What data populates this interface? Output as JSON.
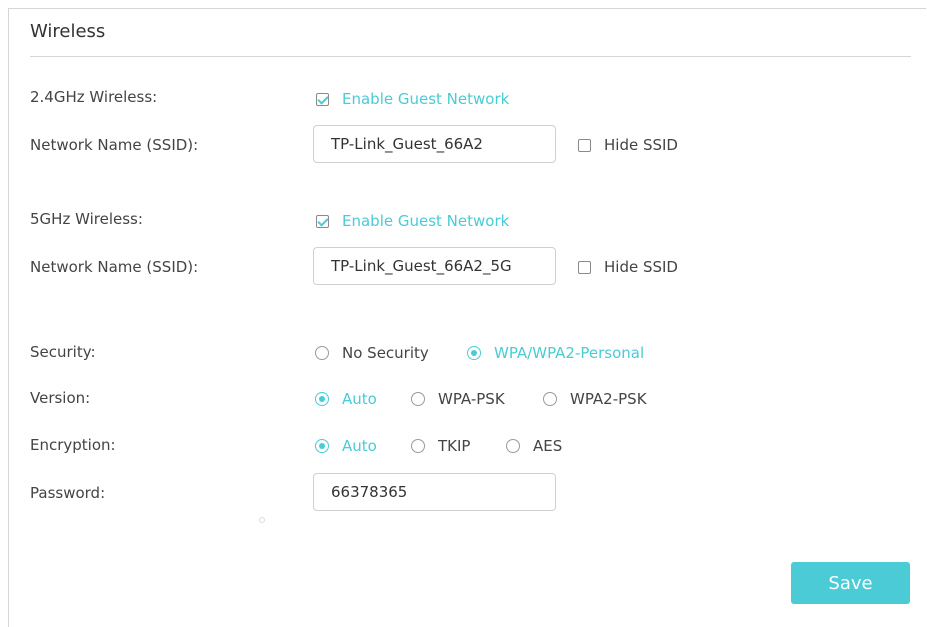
{
  "section": {
    "title": "Wireless"
  },
  "band24": {
    "label": "2.4GHz Wireless:",
    "enable_label": "Enable Guest Network",
    "enable_checked": true,
    "ssid_label": "Network Name (SSID):",
    "ssid_value": "TP-Link_Guest_66A2",
    "hide_label": "Hide SSID",
    "hide_checked": false
  },
  "band5": {
    "label": "5GHz Wireless:",
    "enable_label": "Enable Guest Network",
    "enable_checked": true,
    "ssid_label": "Network Name (SSID):",
    "ssid_value": "TP-Link_Guest_66A2_5G",
    "hide_label": "Hide SSID",
    "hide_checked": false
  },
  "security": {
    "label": "Security:",
    "options": [
      "No Security",
      "WPA/WPA2-Personal"
    ],
    "selected": "WPA/WPA2-Personal"
  },
  "version": {
    "label": "Version:",
    "options": [
      "Auto",
      "WPA-PSK",
      "WPA2-PSK"
    ],
    "selected": "Auto"
  },
  "encryption": {
    "label": "Encryption:",
    "options": [
      "Auto",
      "TKIP",
      "AES"
    ],
    "selected": "Auto"
  },
  "password": {
    "label": "Password:",
    "value": "66378365"
  },
  "actions": {
    "save_label": "Save"
  },
  "colors": {
    "accent": "#4acbd6",
    "text": "#333333",
    "border": "#d6d6d6"
  }
}
